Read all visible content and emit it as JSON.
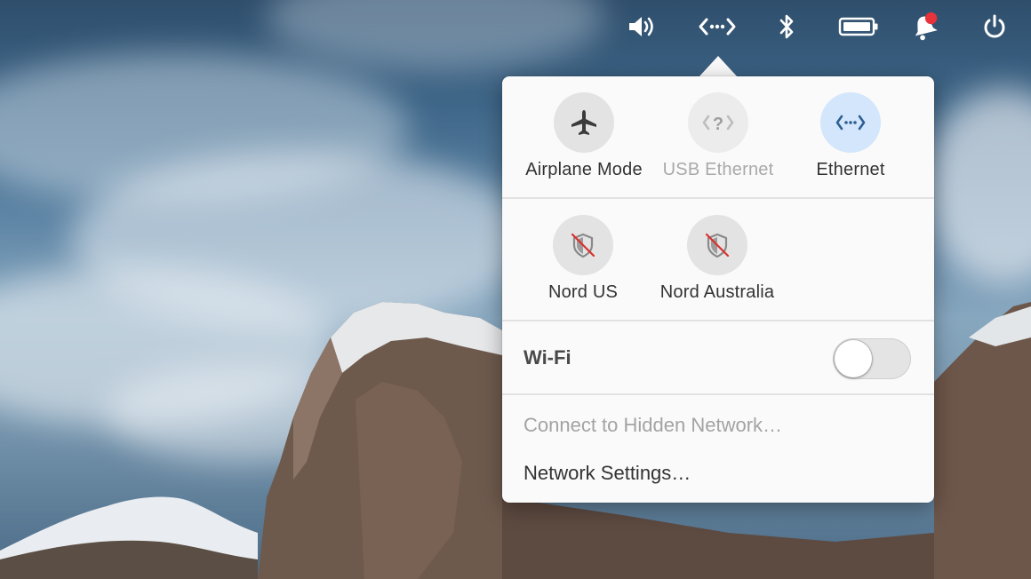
{
  "topbar": {
    "indicators": [
      {
        "name": "volume",
        "icon": "speaker-volume-icon"
      },
      {
        "name": "network",
        "icon": "wired-network-icon"
      },
      {
        "name": "bluetooth",
        "icon": "bluetooth-icon"
      },
      {
        "name": "battery",
        "icon": "battery-full-icon"
      },
      {
        "name": "notifications",
        "icon": "bell-icon",
        "badge_color": "#e8333a"
      },
      {
        "name": "session",
        "icon": "power-icon"
      }
    ]
  },
  "network_popover": {
    "tiles": [
      {
        "label": "Airplane Mode",
        "icon": "airplane-icon",
        "state": "off"
      },
      {
        "label": "USB Ethernet",
        "icon": "ethernet-unknown-icon",
        "state": "disabled"
      },
      {
        "label": "Ethernet",
        "icon": "ethernet-icon",
        "state": "active"
      }
    ],
    "vpns": [
      {
        "label": "Nord US",
        "icon": "vpn-disconnected-icon"
      },
      {
        "label": "Nord Australia",
        "icon": "vpn-disconnected-icon"
      }
    ],
    "wifi": {
      "label": "Wi-Fi",
      "enabled": false
    },
    "menu": {
      "hidden_network": "Connect to Hidden Network…",
      "settings": "Network Settings…"
    },
    "colors": {
      "active_tile": "#d3e6fb",
      "active_icon": "#2c5f94",
      "vpn_slash": "#d9302e"
    }
  }
}
